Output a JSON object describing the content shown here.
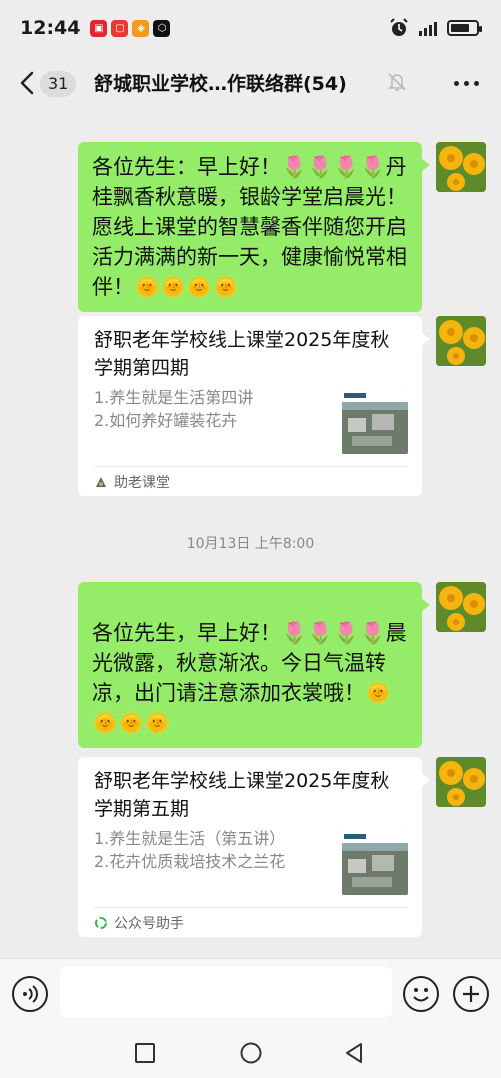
{
  "status_bar": {
    "time": "12:44",
    "battery_level": 0.75
  },
  "header": {
    "unread_count": "31",
    "title": "舒城职业学校…作联络群(54)"
  },
  "messages": [
    {
      "type": "text",
      "text": "各位先生：早上好！🌷🌷🌷🌷丹桂飘香秋意暖，银龄学堂启晨光！愿线上课堂的智慧馨香伴随您开启活力满满的新一天，健康愉悦常相伴！🌞🌞🌞🌞"
    },
    {
      "type": "card",
      "title": "舒职老年学校线上课堂2025年度秋学期第四期",
      "desc1": "1.养生就是生活第四讲",
      "desc2": "2.如何养好罐装花卉",
      "source": "助老课堂",
      "thumb_caption": "城职业学校"
    },
    {
      "type": "timestamp",
      "text": "10月13日 上午8:00"
    },
    {
      "type": "text",
      "text": "各位先生，早上好！🌷🌷🌷🌷晨光微露，秋意渐浓。今日气温转凉，出门请注意添加衣裳哦！🌞🌞🌞🌞"
    },
    {
      "type": "card",
      "title": "舒职老年学校线上课堂2025年度秋学期第五期",
      "desc1": "1.养生就是生活（第五讲）",
      "desc2": "2.花卉优质栽培技术之兰花",
      "source": "公众号助手",
      "thumb_caption": "城职业学校"
    }
  ],
  "input_bar": {
    "placeholder": ""
  },
  "colors": {
    "bubble": "#95ec69",
    "background": "#ededed",
    "card": "#ffffff"
  }
}
